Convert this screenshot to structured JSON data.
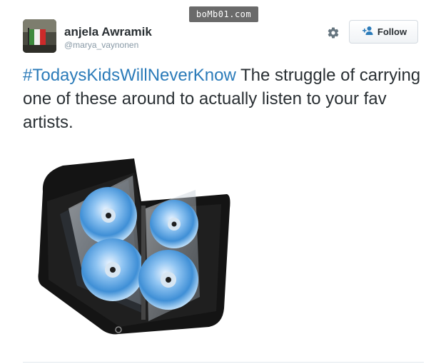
{
  "watermark": {
    "text": "boMb01.com"
  },
  "user": {
    "display_name": "anjela Awramik",
    "handle": "@marya_vaynonen"
  },
  "actions": {
    "settings_icon": "gear-icon",
    "follow_icon": "person-plus-icon",
    "follow_label": "Follow"
  },
  "tweet": {
    "hashtag": "#TodaysKidsWillNeverKnow",
    "text": " The struggle of carrying one of these around to actually listen to your fav artists."
  },
  "media": {
    "subject": "cd-wallet"
  },
  "colors": {
    "hashtag": "#2b7bb9",
    "text": "#292f33",
    "follow_icon": "#2b7bb9"
  }
}
